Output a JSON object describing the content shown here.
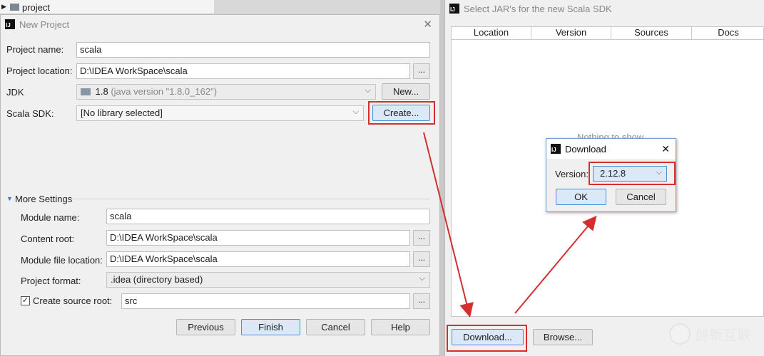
{
  "background": {
    "project_label": "project"
  },
  "new_project": {
    "title": "New Project",
    "labels": {
      "project_name": "Project name:",
      "project_location": "Project location:",
      "jdk": "JDK",
      "scala_sdk": "Scala SDK:",
      "more_settings": "More Settings",
      "module_name": "Module name:",
      "content_root": "Content root:",
      "module_file_location": "Module file location:",
      "project_format": "Project format:",
      "create_source_root": "Create source root:"
    },
    "values": {
      "project_name": "scala",
      "project_location": "D:\\IDEA WorkSpace\\scala",
      "jdk_version": "1.8",
      "jdk_detail": "(java version \"1.8.0_162\")",
      "scala_sdk": "[No library selected]",
      "module_name": "scala",
      "content_root": "D:\\IDEA WorkSpace\\scala",
      "module_file_location": "D:\\IDEA WorkSpace\\scala",
      "project_format": ".idea (directory based)",
      "source_root": "src"
    },
    "buttons": {
      "dots": "...",
      "new": "New...",
      "create": "Create...",
      "previous": "Previous",
      "finish": "Finish",
      "cancel": "Cancel",
      "help": "Help"
    }
  },
  "select_jars": {
    "title": "Select JAR's for the new Scala SDK",
    "columns": [
      "Location",
      "Version",
      "Sources",
      "Docs"
    ],
    "empty_text": "Nothing to show",
    "buttons": {
      "download": "Download...",
      "browse": "Browse..."
    }
  },
  "download_dialog": {
    "title": "Download",
    "close": "✕",
    "version_label": "Version:",
    "version_value": "2.12.8",
    "ok": "OK",
    "cancel": "Cancel"
  },
  "watermark": {
    "text": "创新互联"
  },
  "colors": {
    "annotation_red": "#d32f2f",
    "focus_blue": "#4a8fd6"
  }
}
